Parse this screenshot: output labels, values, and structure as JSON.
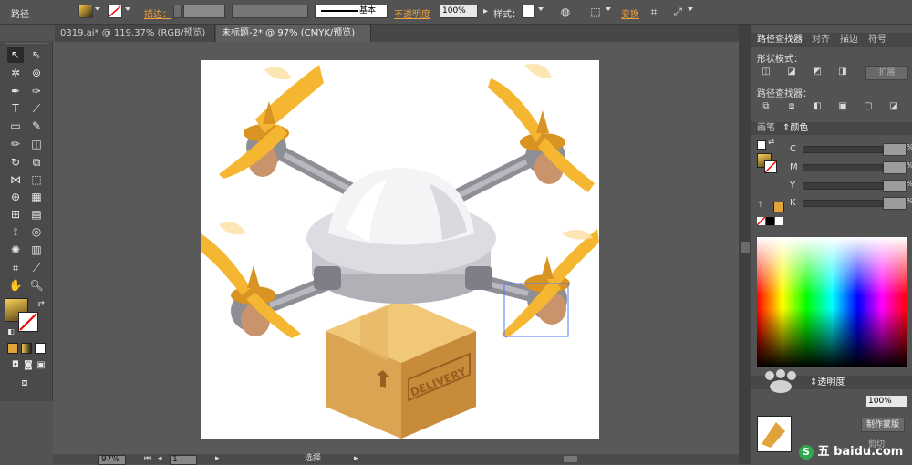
{
  "control_bar": {
    "selection_type": "路径",
    "stroke_label": "描边",
    "stroke_profile": "基本",
    "opacity_label": "不透明度",
    "opacity_value": "100%",
    "style_label": "样式",
    "transform_label": "变换"
  },
  "doc_tabs": [
    {
      "label": "0319.ai* @ 119.37% (RGB/预览)",
      "close": "×"
    },
    {
      "label": "未标题-2* @ 97% (CMYK/预览)",
      "close": "×"
    }
  ],
  "artwork": {
    "box_text": "DELIVERY"
  },
  "pathfinder_panel": {
    "tabs": [
      "路径查找器",
      "对齐",
      "描边",
      "符号"
    ],
    "shape_modes_label": "形状模式：",
    "expand_label": "扩展",
    "pathfinders_label": "路径查找器："
  },
  "color_panel": {
    "tabs": [
      "画笔",
      "颜色"
    ],
    "channels": [
      "C",
      "M",
      "Y",
      "K"
    ],
    "percent": "%"
  },
  "transparency_panel": {
    "tab": "透明度",
    "opacity_value": "100%",
    "make_mask_label": "制作蒙版",
    "clip_label": "剪切"
  },
  "status_bar": {
    "zoom": "97%",
    "artboard_num": "1",
    "status_text": "选择"
  },
  "watermark": {
    "ime": "五",
    "site": "baidu.com"
  },
  "colors": {
    "orange_label": "#f0a040",
    "propeller": "#f5b731",
    "box": "#dba452",
    "dome": "#e9e9ee"
  }
}
